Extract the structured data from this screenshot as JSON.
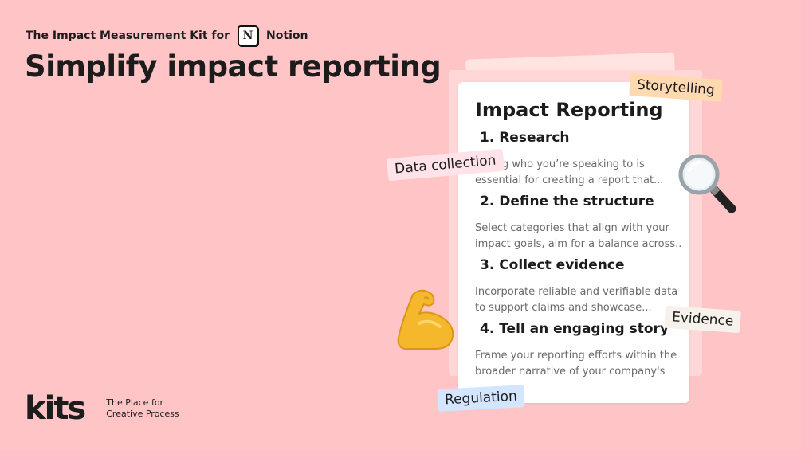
{
  "header": {
    "kit_label": "The Impact Measurement Kit for",
    "notion_label": "Notion",
    "notion_logo_letter": "N",
    "headline": "Simplify impact reporting"
  },
  "document": {
    "title": "Impact Reporting",
    "sections": [
      {
        "heading": "1. Research",
        "text_line1": "ing who you’re speaking to is",
        "text_line2": "essential for creating a report that..."
      },
      {
        "heading": "2. Define the structure",
        "text_line1": "Select categories that align with your",
        "text_line2": "impact goals, aim for a balance across.."
      },
      {
        "heading": "3. Collect evidence",
        "text_line1": "Incorporate reliable and verifiable data",
        "text_line2": "to support claims and showcase..."
      },
      {
        "heading": "4. Tell an engaging story",
        "text_line1": "Frame your reporting efforts within the",
        "text_line2": "broader narrative of your company's"
      }
    ]
  },
  "tags": {
    "storytelling": "Storytelling",
    "data_collection": "Data collection",
    "evidence": "Evidence",
    "regulation": "Regulation"
  },
  "footer": {
    "logo": "kits",
    "tagline_line1": "The Place for",
    "tagline_line2": "Creative Process"
  },
  "icons": [
    "magnifying-glass-icon",
    "flexed-biceps-icon",
    "notion-logo-icon",
    "kits-logo"
  ],
  "colors": {
    "background": "#ffc4c6",
    "storytelling_tag": "#ffd9b0",
    "data_tag": "#ffe3e8",
    "evidence_tag": "#f6f1ea",
    "regulation_tag": "#d3e5ff"
  }
}
